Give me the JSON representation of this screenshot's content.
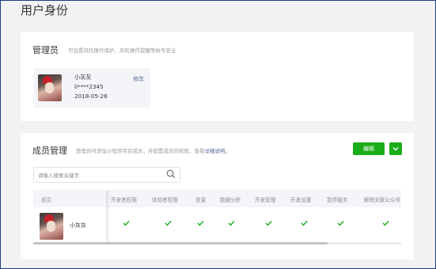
{
  "page": {
    "title": "用户身份"
  },
  "admin_card": {
    "title": "管理员",
    "description": "可设置风险操作保护、风险操作提醒等帐号安全",
    "admin": {
      "name": "小灰灰",
      "account": "li****2345",
      "date": "2018-05-26",
      "edit_label": "修改"
    }
  },
  "member_card": {
    "title": "成员管理",
    "description": "管理员可添加小程序项目成员，并配置成员的权限，查看",
    "description_link": "详细说明。",
    "edit_button": "编辑",
    "more_icon": "chevron-down-icon",
    "search": {
      "placeholder": "请输入搜索关键字",
      "icon": "search-icon"
    },
    "table": {
      "columns": [
        "成员",
        "开发者权限",
        "体验者权限",
        "登录",
        "数据分析",
        "开发管理",
        "开发设置",
        "暂停服务",
        "解除关联公众号"
      ],
      "rows": [
        {
          "member": "小灰灰",
          "permissions": [
            true,
            true,
            true,
            true,
            true,
            true,
            true,
            true
          ]
        }
      ],
      "scroll_fraction": 0.8
    }
  },
  "colors": {
    "accent": "#1aad19",
    "link": "#576b95",
    "background": "#f2f2f4"
  }
}
